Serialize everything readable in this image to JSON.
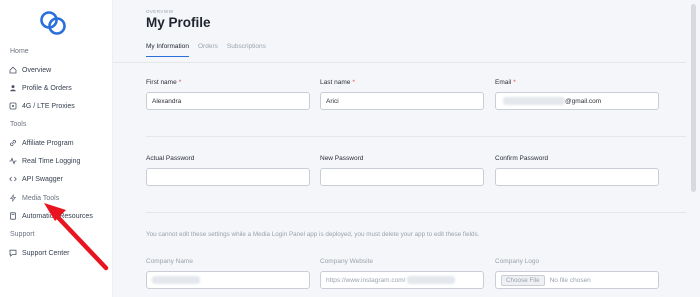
{
  "sidebar": {
    "sections": [
      {
        "heading": "Home",
        "items": [
          {
            "label": "Overview",
            "icon": "house-icon"
          },
          {
            "label": "Profile & Orders",
            "icon": "user-icon"
          },
          {
            "label": "4G / LTE Proxies",
            "icon": "wifi-icon"
          }
        ]
      },
      {
        "heading": "Tools",
        "items": [
          {
            "label": "Affiliate Program",
            "icon": "link-icon"
          },
          {
            "label": "Real Time Logging",
            "icon": "activity-icon"
          },
          {
            "label": "API Swagger",
            "icon": "code-icon"
          },
          {
            "label": "Media Tools",
            "icon": "lightning-icon"
          },
          {
            "label": "Automation Resources",
            "icon": "book-icon"
          }
        ]
      },
      {
        "heading": "Support",
        "items": [
          {
            "label": "Support Center",
            "icon": "chat-icon"
          }
        ]
      }
    ]
  },
  "header": {
    "breadcrumb": "OVERVIEW",
    "title": "My Profile",
    "tabs": [
      "My Information",
      "Orders",
      "Subscriptions"
    ]
  },
  "profile": {
    "first_name_label": "First name",
    "first_name_value": "Alexandra",
    "last_name_label": "Last name",
    "last_name_value": "Arici",
    "email_label": "Email",
    "email_value": "@gmail.com",
    "required_mark": "*"
  },
  "password": {
    "actual_label": "Actual Password",
    "new_label": "New Password",
    "confirm_label": "Confirm Password"
  },
  "company": {
    "note": "You cannot edit these settings while a Media Login Panel app is deployed, you must delete your app to edit these fields.",
    "name_label": "Company Name",
    "website_label": "Company Website",
    "website_value": "https://www.instagram.com/",
    "logo_label": "Company Logo",
    "choose_file": "Choose File",
    "no_file": "No file chosen"
  },
  "colors": {
    "accent": "#2a6fdb",
    "required": "#e5484d",
    "annotation_arrow": "#e8141f"
  }
}
